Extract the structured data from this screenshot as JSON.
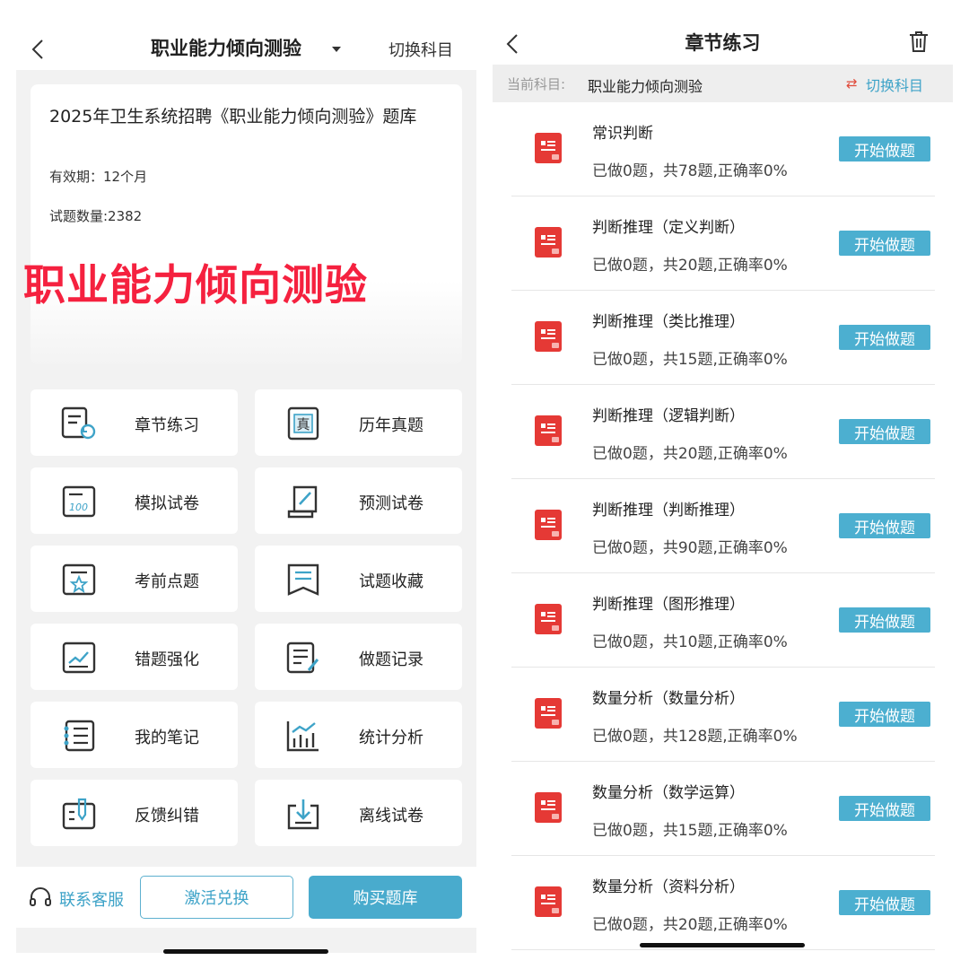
{
  "left": {
    "nav": {
      "title": "职业能力倾向测验",
      "switch_label": "切换科目"
    },
    "hero": {
      "title": "2025年卫生系统招聘《职业能力倾向测验》题库",
      "validity": "有效期：12个月",
      "count": "试题数量:2382",
      "banner": "职业能力倾向测验"
    },
    "grid": [
      {
        "label": "章节练习",
        "icon": "chapter-practice-icon"
      },
      {
        "label": "历年真题",
        "icon": "past-papers-icon"
      },
      {
        "label": "模拟试卷",
        "icon": "mock-exam-icon"
      },
      {
        "label": "预测试卷",
        "icon": "forecast-exam-icon"
      },
      {
        "label": "考前点题",
        "icon": "key-points-icon"
      },
      {
        "label": "试题收藏",
        "icon": "bookmark-icon"
      },
      {
        "label": "错题强化",
        "icon": "wrong-questions-icon"
      },
      {
        "label": "做题记录",
        "icon": "history-record-icon"
      },
      {
        "label": "我的笔记",
        "icon": "notes-icon"
      },
      {
        "label": "统计分析",
        "icon": "statistics-icon"
      },
      {
        "label": "反馈纠错",
        "icon": "feedback-icon"
      },
      {
        "label": "离线试卷",
        "icon": "download-icon"
      }
    ],
    "footer": {
      "service": "联系客服",
      "activate": "激活兑换",
      "buy": "购买题库"
    }
  },
  "right": {
    "nav": {
      "title": "章节练习"
    },
    "subject": {
      "key": "当前科目:",
      "value": "职业能力倾向测验",
      "switch_icon": "⇄",
      "switch_label": "切换科目"
    },
    "start_label": "开始做题",
    "rows": [
      {
        "title": "常识判断",
        "stats": "已做0题，共78题,正确率0%"
      },
      {
        "title": "判断推理（定义判断）",
        "stats": "已做0题，共20题,正确率0%"
      },
      {
        "title": "判断推理（类比推理）",
        "stats": "已做0题，共15题,正确率0%"
      },
      {
        "title": "判断推理（逻辑判断）",
        "stats": "已做0题，共20题,正确率0%"
      },
      {
        "title": "判断推理（判断推理）",
        "stats": "已做0题，共90题,正确率0%"
      },
      {
        "title": "判断推理（图形推理）",
        "stats": "已做0题，共10题,正确率0%"
      },
      {
        "title": "数量分析（数量分析）",
        "stats": "已做0题，共128题,正确率0%"
      },
      {
        "title": "数量分析（数学运算）",
        "stats": "已做0题，共15题,正确率0%"
      },
      {
        "title": "数量分析（资料分析）",
        "stats": "已做0题，共20题,正确率0%"
      }
    ]
  },
  "colors": {
    "accent": "#49abcd",
    "banner_red": "#f5213f",
    "icon_red": "#e53935"
  }
}
